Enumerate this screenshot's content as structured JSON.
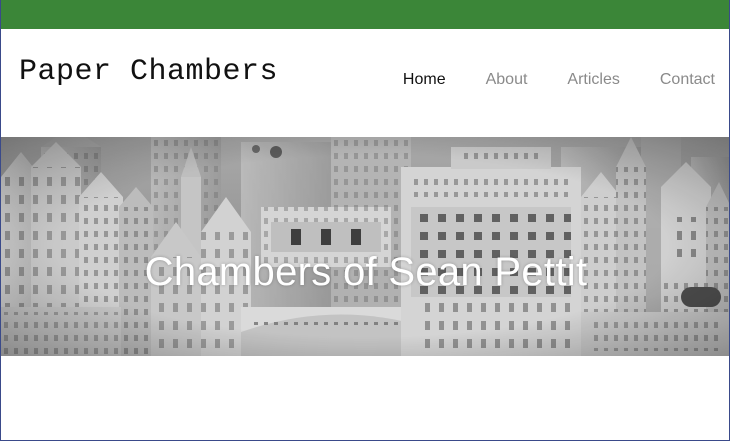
{
  "colors": {
    "top_bar": "#3b8638",
    "nav_active": "#111111",
    "nav_inactive": "#8a8a8a"
  },
  "header": {
    "site_title": "Paper Chambers"
  },
  "nav": {
    "items": [
      {
        "label": "Home",
        "active": true
      },
      {
        "label": "About",
        "active": false
      },
      {
        "label": "Articles",
        "active": false
      },
      {
        "label": "Contact",
        "active": false
      }
    ]
  },
  "hero": {
    "title": "Chambers of Sean Pettit"
  }
}
